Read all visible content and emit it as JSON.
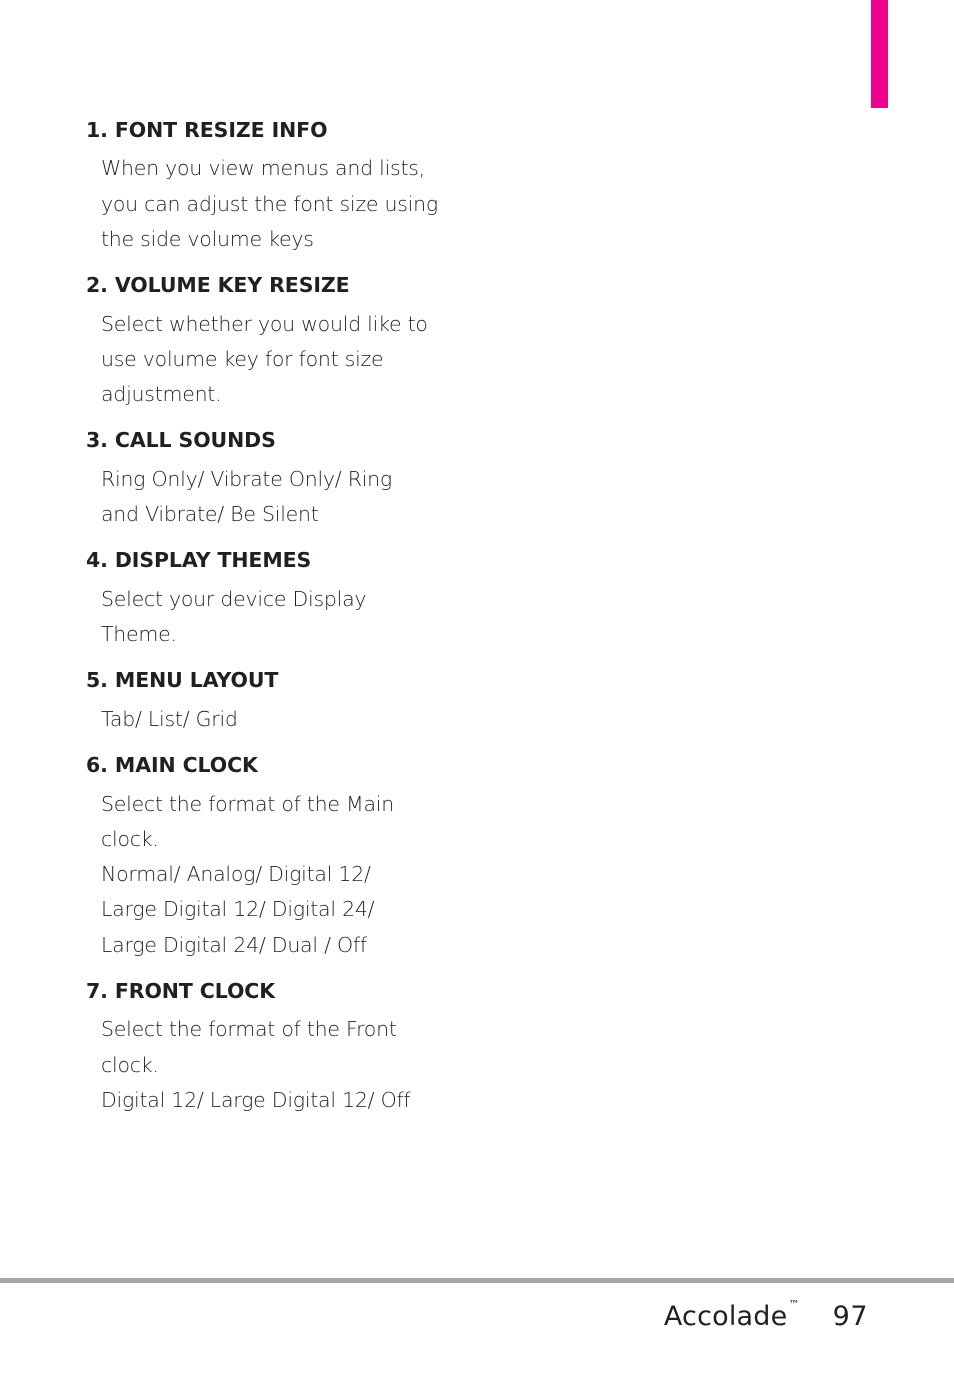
{
  "page": {
    "background_color": "#ffffff",
    "text_color": "#231f20"
  },
  "tab_marker": {
    "color": "#ec008c"
  },
  "sections": [
    {
      "heading": "1. FONT RESIZE INFO",
      "lines": [
        "When you view menus and lists,",
        "you can adjust the font size using",
        "the side volume keys"
      ]
    },
    {
      "heading": "2. VOLUME KEY RESIZE",
      "lines": [
        "Select whether you would like to",
        "use volume key for font size",
        "adjustment."
      ]
    },
    {
      "heading": "3. CALL SOUNDS",
      "lines": [
        "Ring Only/ Vibrate Only/ Ring",
        "and Vibrate/ Be Silent"
      ]
    },
    {
      "heading": "4. DISPLAY THEMES",
      "lines": [
        "Select your device Display",
        "Theme."
      ]
    },
    {
      "heading": "5. MENU LAYOUT",
      "lines": [
        "Tab/ List/ Grid"
      ]
    },
    {
      "heading": "6. MAIN CLOCK",
      "lines": [
        "Select the format of the Main",
        "clock.",
        "Normal/ Analog/ Digital 12/",
        "Large Digital 12/ Digital 24/",
        "Large Digital 24/ Dual / Off"
      ]
    },
    {
      "heading": "7. FRONT CLOCK",
      "lines": [
        "Select the format of the Front",
        "clock.",
        "Digital 12/ Large Digital 12/ Off"
      ]
    }
  ],
  "footer": {
    "rule_color": "#a7a7a7",
    "brand": "Accolade",
    "trademark": "™",
    "page_number": "97"
  }
}
